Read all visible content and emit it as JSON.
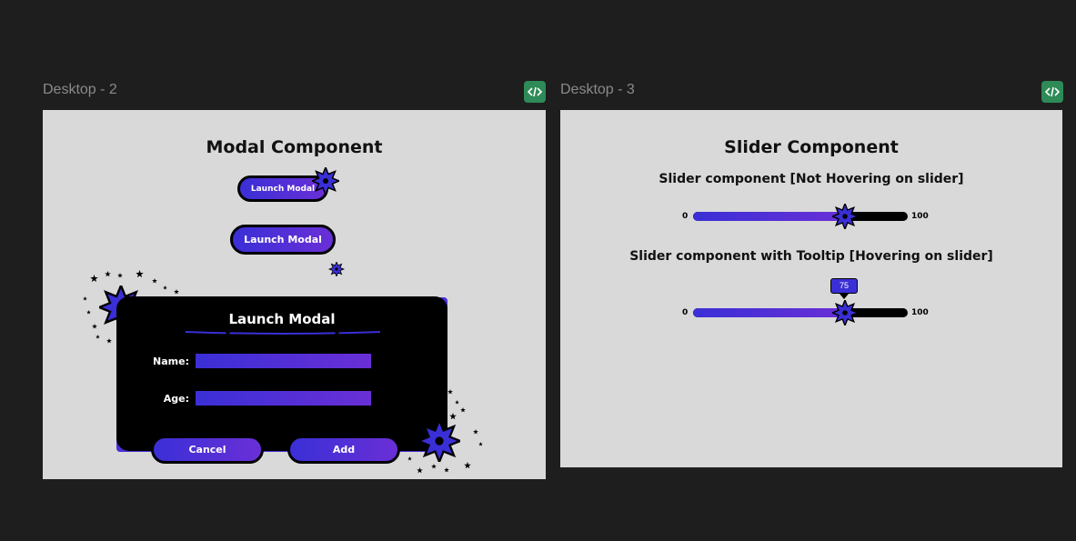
{
  "canvas": {
    "frames": [
      {
        "label": "Desktop - 2"
      },
      {
        "label": "Desktop - 3"
      }
    ]
  },
  "modal_frame": {
    "title": "Modal Component",
    "launch_button_small": "Launch Modal",
    "launch_button_large": "Launch Modal",
    "modal": {
      "title": "Launch Modal",
      "fields": [
        {
          "label": "Name:",
          "value": ""
        },
        {
          "label": "Age:",
          "value": ""
        }
      ],
      "cancel_label": "Cancel",
      "add_label": "Add"
    }
  },
  "slider_frame": {
    "title": "Slider Component",
    "sliders": [
      {
        "caption": "Slider component [Not Hovering on slider]",
        "min": "0",
        "max": "100",
        "value": 75,
        "tooltip": null
      },
      {
        "caption": "Slider component with Tooltip [Hovering on slider]",
        "min": "0",
        "max": "100",
        "value": 75,
        "tooltip": "75"
      }
    ]
  },
  "colors": {
    "accent_start": "#3a2fd6",
    "accent_end": "#6a2fd6",
    "frame_bg": "#d9d9d9",
    "canvas_bg": "#1e1e1e",
    "code_badge": "#2e8b57"
  },
  "icons": [
    "code-icon",
    "starburst-icon",
    "star-icon"
  ]
}
